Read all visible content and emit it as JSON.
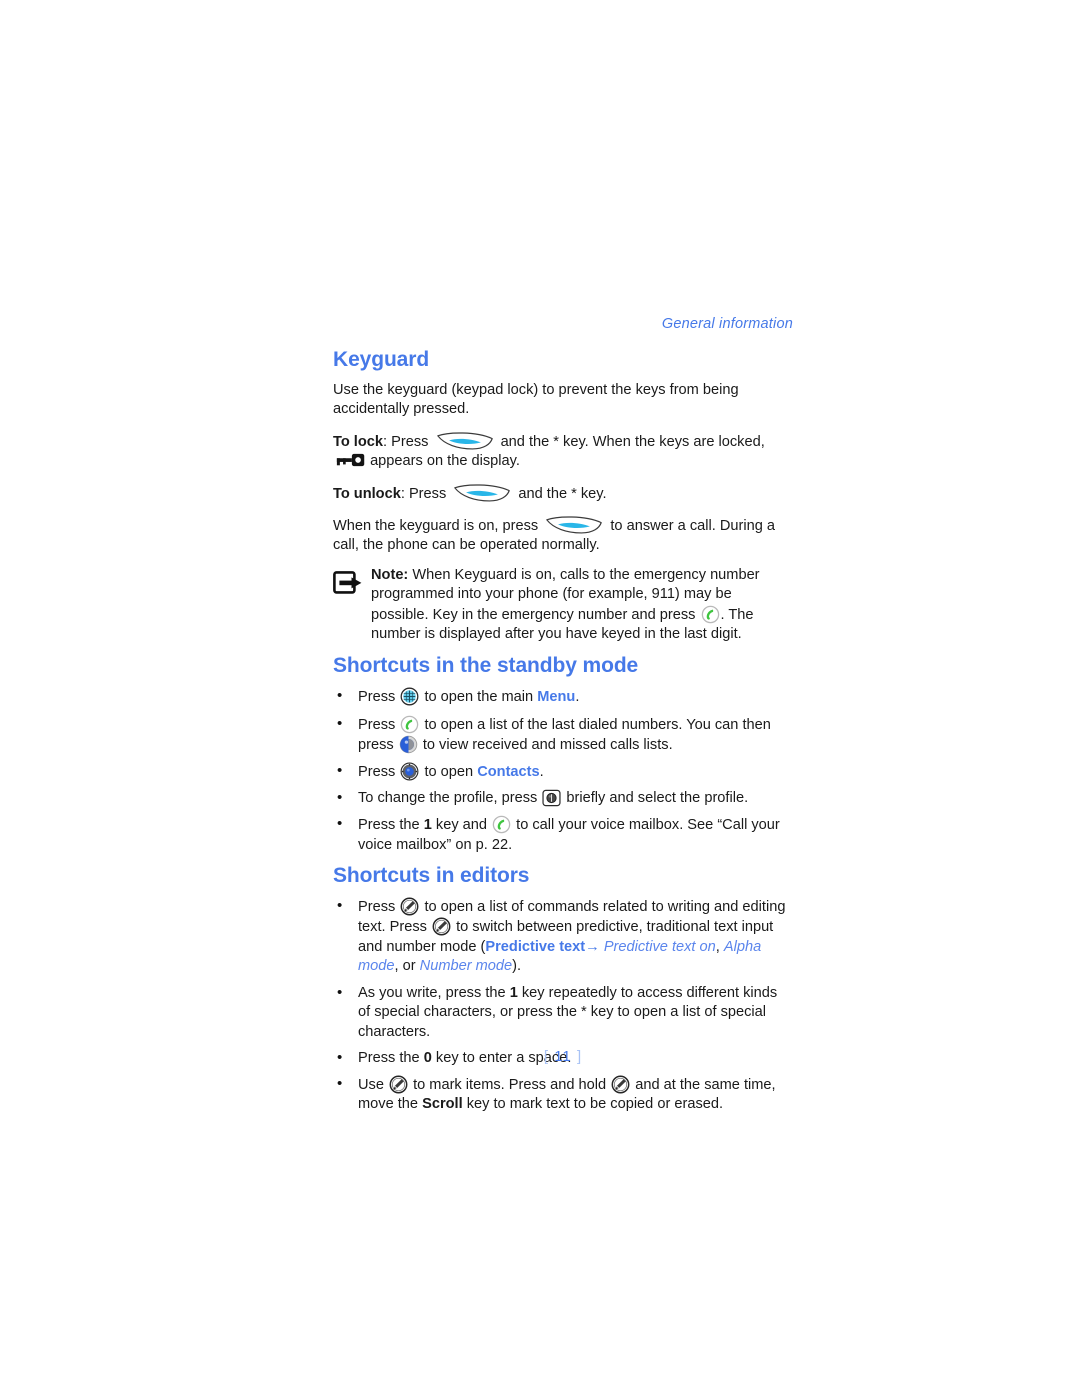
{
  "running_head": "General information",
  "page_number": "11",
  "page_number_open_bracket": "[",
  "page_number_close_bracket": "]",
  "colors": {
    "heading_blue": "#4679e8",
    "link_blue": "#4679e8",
    "italic_blue": "#5b85ec",
    "bracket_blue": "#a9c3f5",
    "softkey_cyan": "#29b6e8",
    "call_green": "#3fc53f",
    "nav_blue": "#2a5fd8",
    "text_black": "#1a1a1a"
  },
  "sections": {
    "keyguard": {
      "title": "Keyguard",
      "intro": "Use the keyguard (keypad lock) to prevent the keys from being accidentally pressed.",
      "to_lock_label": "To lock",
      "to_lock_part1": ": Press",
      "to_lock_part2": "and the * key. When the keys are locked,",
      "to_lock_part3": "appears on the display.",
      "to_unlock_label": "To unlock",
      "to_unlock_part1": ": Press",
      "to_unlock_part2": "and the * key.",
      "keyguard_on_part1": "When the keyguard is on, press",
      "keyguard_on_part2": "to answer a call. During a call, the phone can be operated normally.",
      "note": {
        "label": "Note:",
        "part1": "When Keyguard is on, calls to the emergency number programmed into your phone (for example, 911) may be possible. Key in the emergency number and press",
        "part2": ". The number is displayed after you have keyed in the last digit."
      }
    },
    "standby_shortcuts": {
      "title": "Shortcuts in the standby mode",
      "items": [
        {
          "part1": "Press",
          "part2": "to open the main",
          "link": "Menu",
          "part3": "."
        },
        {
          "part1": "Press",
          "part2": "to open a list of the last dialed numbers. You can then press",
          "part3": "to view received and missed calls lists."
        },
        {
          "part1": "Press",
          "part2": "to open",
          "link": "Contacts",
          "part3": "."
        },
        {
          "part1": "To change the profile, press",
          "part2": "briefly and select the profile."
        },
        {
          "part1": "Press the",
          "bold": "1",
          "part2": "key and",
          "part3": "to call your voice mailbox. See “Call your voice mailbox” on p. 22."
        }
      ]
    },
    "editor_shortcuts": {
      "title": "Shortcuts in editors",
      "items": [
        {
          "part1": "Press",
          "part2": "to open a list of commands related to writing and editing text. Press",
          "part3": "to switch between predictive, traditional text input and number mode (",
          "link1": "Predictive text",
          "arrow": "→",
          "italic1": "Predictive text on",
          "sep1": ",",
          "italic2": "Alpha mode",
          "sep2": ", or",
          "italic3": "Number mode",
          "part4": ")."
        },
        {
          "part1": "As you write, press the",
          "bold": "1",
          "part2": "key repeatedly to access different kinds of special characters, or press the * key to open a list of special characters."
        },
        {
          "part1": "Press the",
          "bold": "0",
          "part2": "key to enter a space."
        },
        {
          "part1": "Use",
          "part2": "to mark items. Press and hold",
          "part3": "and at the same time, move the",
          "bold": "Scroll",
          "part4": "key to mark text to be copied or erased."
        }
      ]
    }
  },
  "icons": {
    "softkey": "softkey-icon",
    "keylock": "keylock-icon",
    "call": "call-key-icon",
    "menu": "menu-key-icon",
    "scroll": "scroll-key-icon",
    "navi": "navi-key-icon",
    "power": "power-key-icon",
    "edit": "edit-key-icon",
    "note": "note-icon"
  }
}
